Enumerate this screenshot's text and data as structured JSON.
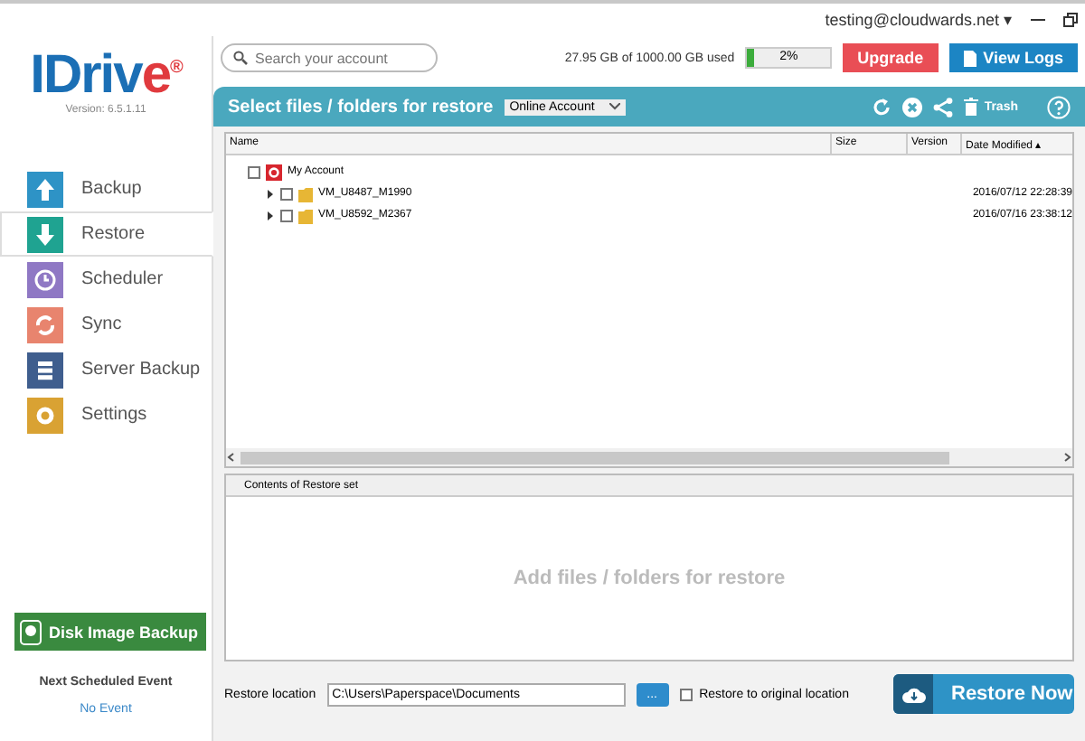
{
  "account": {
    "email": "testing@cloudwards.net",
    "caret": "▾"
  },
  "logo": {
    "text_main": "IDriv",
    "text_accent": "e",
    "mark": "®",
    "version": "Version: 6.5.1.11"
  },
  "search": {
    "placeholder": "Search your account"
  },
  "storage": {
    "text": "27.95 GB of 1000.00 GB used",
    "level": 0.02,
    "reading": "2%"
  },
  "top_buttons": [
    {
      "kind": "upgrade",
      "label": "Upgrade"
    },
    {
      "kind": "logs",
      "label": "View Logs"
    }
  ],
  "sidebar": {
    "items": [
      {
        "kind": "backup",
        "label": "Backup",
        "selected": false
      },
      {
        "kind": "restore",
        "label": "Restore",
        "selected": true
      },
      {
        "kind": "scheduler",
        "label": "Scheduler",
        "selected": false
      },
      {
        "kind": "sync",
        "label": "Sync",
        "selected": false
      },
      {
        "kind": "server",
        "label": "Server Backup",
        "selected": false
      },
      {
        "kind": "settings",
        "label": "Settings",
        "selected": false
      }
    ],
    "disk_image_button": "Disk Image Backup",
    "next_event_title": "Next Scheduled Event",
    "next_event": "No Event"
  },
  "panel": {
    "title": "Select files / folders for restore",
    "source": "Online Account",
    "trash": "Trash"
  },
  "table": {
    "columns": [
      "Name",
      "Size",
      "Version",
      "Date Modified"
    ],
    "sort_indicator": "▴",
    "tree": [
      {
        "name": "My Account",
        "checked": false,
        "children": [
          {
            "name": "VM_U8487_M1990",
            "checked": false,
            "expanded": false,
            "date": "2016/07/12 22:28:39"
          },
          {
            "name": "VM_U8592_M2367",
            "checked": false,
            "expanded": false,
            "date": "2016/07/16 23:38:12"
          }
        ]
      }
    ]
  },
  "restore_set": {
    "title": "Contents of Restore set",
    "empty": "Add files / folders for restore"
  },
  "footer": {
    "location_label": "Restore location",
    "location": "C:\\Users\\Paperspace\\Documents",
    "browse": "...",
    "original": {
      "label": "Restore to original location",
      "checked": false
    },
    "restore_button": "Restore Now"
  }
}
